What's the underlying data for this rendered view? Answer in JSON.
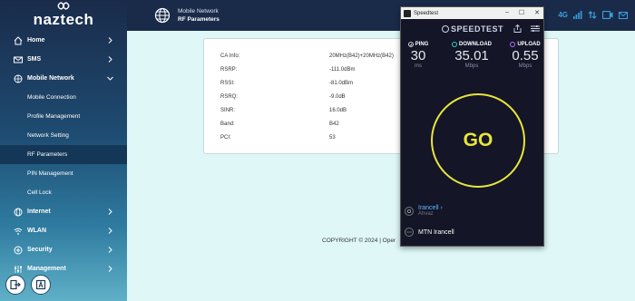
{
  "brand": {
    "name": "naztech"
  },
  "sidebar": {
    "items": [
      {
        "label": "Home",
        "icon": "home-icon",
        "type": "main",
        "chevron": "right"
      },
      {
        "label": "SMS",
        "icon": "mail-icon",
        "type": "main",
        "chevron": "right"
      },
      {
        "label": "Mobile Network",
        "icon": "network-icon",
        "type": "main",
        "chevron": "down"
      },
      {
        "label": "Mobile Connection",
        "type": "sub"
      },
      {
        "label": "Profile Management",
        "type": "sub"
      },
      {
        "label": "Network Setting",
        "type": "sub"
      },
      {
        "label": "RF Parameters",
        "type": "sub",
        "active": true
      },
      {
        "label": "PIN Management",
        "type": "sub"
      },
      {
        "label": "Cell Lock",
        "type": "sub"
      },
      {
        "label": "Internet",
        "icon": "globe-icon",
        "type": "main",
        "chevron": "right"
      },
      {
        "label": "WLAN",
        "icon": "wifi-icon",
        "type": "main",
        "chevron": "right"
      },
      {
        "label": "Security",
        "icon": "shield-icon",
        "type": "main",
        "chevron": "right"
      },
      {
        "label": "Management",
        "icon": "sliders-icon",
        "type": "main",
        "chevron": "right"
      }
    ]
  },
  "header": {
    "breadcrumb_parent": "Mobile Network",
    "breadcrumb_current": "RF Parameters",
    "network_type": "4G"
  },
  "rf": {
    "rows": [
      {
        "label": "CA Info:",
        "value": "20MHz(B42)+20MHz(B42)"
      },
      {
        "label": "RSRP:",
        "value": "-111.0dBm"
      },
      {
        "label": "RSSI:",
        "value": "-81.0dBm"
      },
      {
        "label": "RSRQ:",
        "value": "-9.0dB"
      },
      {
        "label": "SINR:",
        "value": "16.0dB"
      },
      {
        "label": "Band:",
        "value": "B42"
      },
      {
        "label": "PCI:",
        "value": "53"
      }
    ]
  },
  "footer": {
    "copyright": "COPYRIGHT © 2024 | Oper"
  },
  "speedtest": {
    "window_title": "Speedtest",
    "logo": "SPEEDTEST",
    "ping": {
      "label": "PING",
      "value": "30",
      "unit": "ms",
      "color": "#ffffff"
    },
    "download": {
      "label": "DOWNLOAD",
      "value": "35.01",
      "unit": "Mbps",
      "color": "#2fd0c0"
    },
    "upload": {
      "label": "UPLOAD",
      "value": "0.55",
      "unit": "Mbps",
      "color": "#b86bff"
    },
    "go_label": "GO",
    "provider": {
      "name": "Irancell",
      "location": "Ahvaz"
    },
    "server": {
      "name": "MTN Irancell"
    }
  },
  "colors": {
    "accent_yellow": "#e8e63a",
    "sidebar_dark": "#1a2b4a",
    "content_bg": "#dff7f7"
  }
}
